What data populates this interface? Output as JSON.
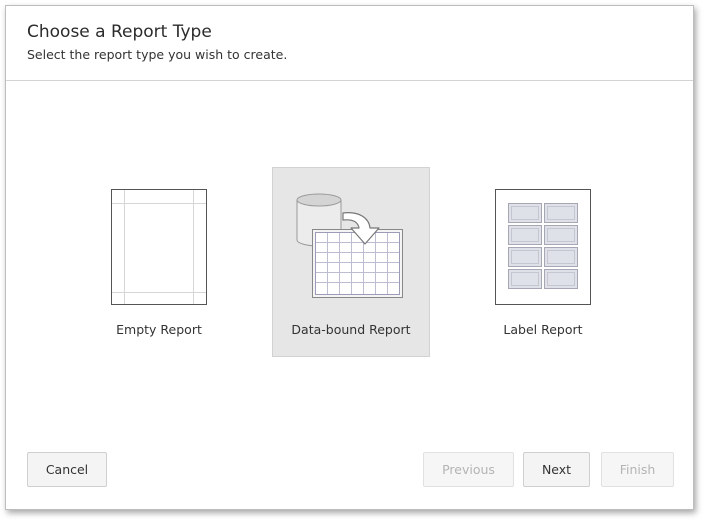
{
  "dialog": {
    "title": "Choose a Report Type",
    "subtitle": "Select the report type you wish to create."
  },
  "report_types": [
    {
      "label": "Empty Report",
      "icon": "empty-report-icon",
      "selected": false
    },
    {
      "label": "Data-bound Report",
      "icon": "data-bound-report-icon",
      "selected": true
    },
    {
      "label": "Label Report",
      "icon": "label-report-icon",
      "selected": false
    }
  ],
  "buttons": {
    "cancel": "Cancel",
    "previous": "Previous",
    "next": "Next",
    "finish": "Finish"
  },
  "colors": {
    "selected_background": "#e6e6e6",
    "disabled_text": "#b4b4b4"
  }
}
